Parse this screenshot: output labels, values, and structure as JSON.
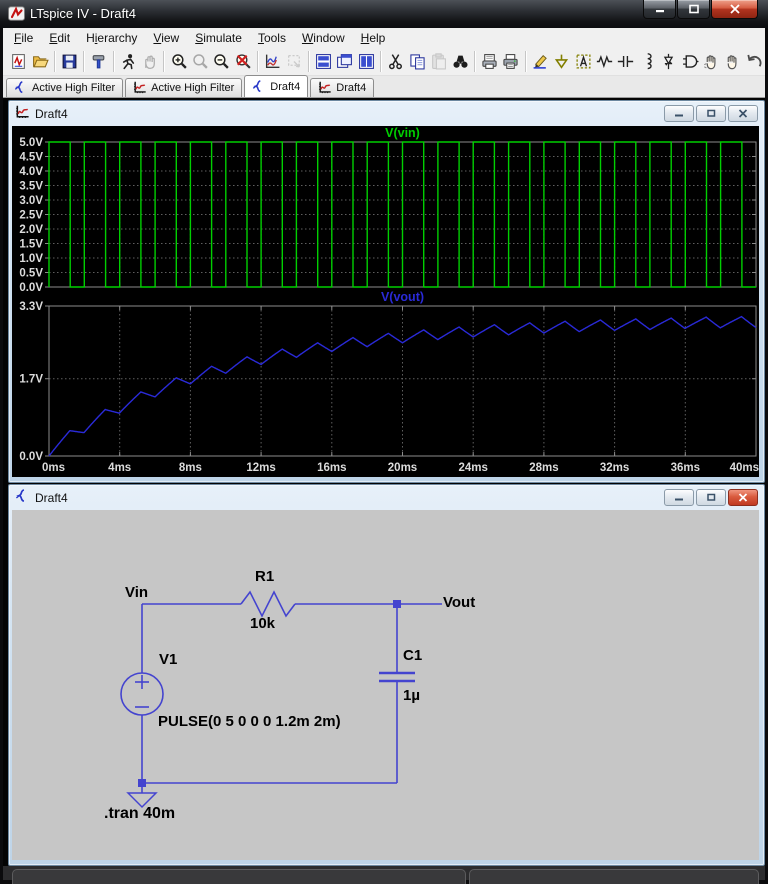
{
  "window": {
    "title": "LTspice IV - Draft4"
  },
  "menu": {
    "items": [
      {
        "label": "File",
        "u": 0
      },
      {
        "label": "Edit",
        "u": 0
      },
      {
        "label": "Hierarchy",
        "u": 1
      },
      {
        "label": "View",
        "u": 0
      },
      {
        "label": "Simulate",
        "u": 0
      },
      {
        "label": "Tools",
        "u": 0
      },
      {
        "label": "Window",
        "u": 0
      },
      {
        "label": "Help",
        "u": 0
      }
    ]
  },
  "toolbar": {
    "groups": [
      [
        {
          "icon": "new-schematic"
        },
        {
          "icon": "open"
        }
      ],
      [
        {
          "icon": "save"
        }
      ],
      [
        {
          "icon": "control-panel"
        }
      ],
      [
        {
          "icon": "run"
        },
        {
          "icon": "halt",
          "disabled": true
        }
      ],
      [
        {
          "icon": "zoom-in"
        },
        {
          "icon": "zoom-back",
          "disabled": true
        },
        {
          "icon": "zoom-out"
        },
        {
          "icon": "zoom-full"
        }
      ],
      [
        {
          "icon": "autorange"
        },
        {
          "icon": "mark-data",
          "disabled": true
        }
      ],
      [
        {
          "icon": "tile-horizontal"
        },
        {
          "icon": "cascade"
        },
        {
          "icon": "tile-vertical"
        }
      ],
      [
        {
          "icon": "cut"
        },
        {
          "icon": "copy"
        },
        {
          "icon": "paste",
          "disabled": true
        },
        {
          "icon": "find"
        }
      ],
      [
        {
          "icon": "print-preview"
        },
        {
          "icon": "print"
        }
      ],
      [
        {
          "icon": "wire"
        },
        {
          "icon": "ground"
        },
        {
          "icon": "label"
        },
        {
          "icon": "resistor"
        },
        {
          "icon": "capacitor"
        },
        {
          "icon": "inductor"
        },
        {
          "icon": "diode"
        },
        {
          "icon": "component"
        },
        {
          "icon": "move"
        },
        {
          "icon": "drag"
        },
        {
          "icon": "undo"
        }
      ]
    ]
  },
  "tabs": [
    {
      "icon": "schematic",
      "label": "Active High Filter",
      "active": false
    },
    {
      "icon": "waveform",
      "label": "Active High Filter",
      "active": false
    },
    {
      "icon": "schematic",
      "label": "Draft4",
      "active": true
    },
    {
      "icon": "waveform",
      "label": "Draft4",
      "active": false
    }
  ],
  "wave_window": {
    "title": "Draft4",
    "panes": [
      {
        "label": "V(vin)",
        "color": "#00cf00",
        "ylabels": [
          "5.0V",
          "4.5V",
          "4.0V",
          "3.5V",
          "3.0V",
          "2.5V",
          "2.0V",
          "1.5V",
          "1.0V",
          "0.5V",
          "0.0V"
        ],
        "ylim": [
          0,
          5
        ]
      },
      {
        "label": "V(vout)",
        "color": "#2a2ad8",
        "ylabels": [
          "3.3V",
          "1.7V",
          "0.0V"
        ],
        "ytick_vals": [
          3.3,
          1.7,
          0
        ],
        "ylim": [
          0,
          3.3
        ]
      }
    ],
    "xlabels": [
      "0ms",
      "4ms",
      "8ms",
      "12ms",
      "16ms",
      "20ms",
      "24ms",
      "28ms",
      "32ms",
      "36ms",
      "40ms"
    ],
    "xlim_ms": [
      0,
      40
    ]
  },
  "chart_data": [
    {
      "type": "line",
      "title": "V(vin)",
      "bg": "black",
      "grid": true,
      "series": [
        {
          "name": "V(vin)",
          "color": "#00cf00",
          "waveform": "pulse",
          "v_low": 0,
          "v_high": 5,
          "t_delay_ms": 0,
          "t_rise_ms": 0,
          "t_fall_ms": 0,
          "t_on_ms": 1.2,
          "period_ms": 2
        }
      ],
      "xlim": [
        0,
        40
      ],
      "x_unit": "ms",
      "ylim": [
        0,
        5
      ],
      "yticks": [
        0,
        0.5,
        1,
        1.5,
        2,
        2.5,
        3,
        3.5,
        4,
        4.5,
        5
      ],
      "xticks": [
        0,
        4,
        8,
        12,
        16,
        20,
        24,
        28,
        32,
        36,
        40
      ]
    },
    {
      "type": "line",
      "title": "V(vout)",
      "bg": "black",
      "grid": true,
      "series": [
        {
          "name": "V(vout)",
          "color": "#2a2ad8",
          "waveform": "rc_lowpass_response_of_pulse",
          "tau_ms": 10,
          "approx_final_ripple_v": [
            2.9,
            3.17
          ]
        }
      ],
      "xlim": [
        0,
        40
      ],
      "x_unit": "ms",
      "ylim": [
        0,
        3.3
      ],
      "yticks": [
        0,
        1.7,
        3.3
      ],
      "xticks": [
        0,
        4,
        8,
        12,
        16,
        20,
        24,
        28,
        32,
        36,
        40
      ]
    }
  ],
  "schematic": {
    "title": "Draft4",
    "labels": {
      "vin": "Vin",
      "res_name": "R1",
      "res_value": "10k",
      "vout": "Vout",
      "src_name": "V1",
      "src_value": "PULSE(0 5 0 0 0 1.2m 2m)",
      "cap_name": "C1",
      "cap_value": "1µ",
      "directive": ".tran 40m"
    }
  },
  "colors": {
    "wire": "#4444cf",
    "schem_bg": "#c6c6c6",
    "plot_grid": "#5f5f5f",
    "plot_border": "#8c8c8c",
    "axis_text": "#dcdcdc"
  }
}
